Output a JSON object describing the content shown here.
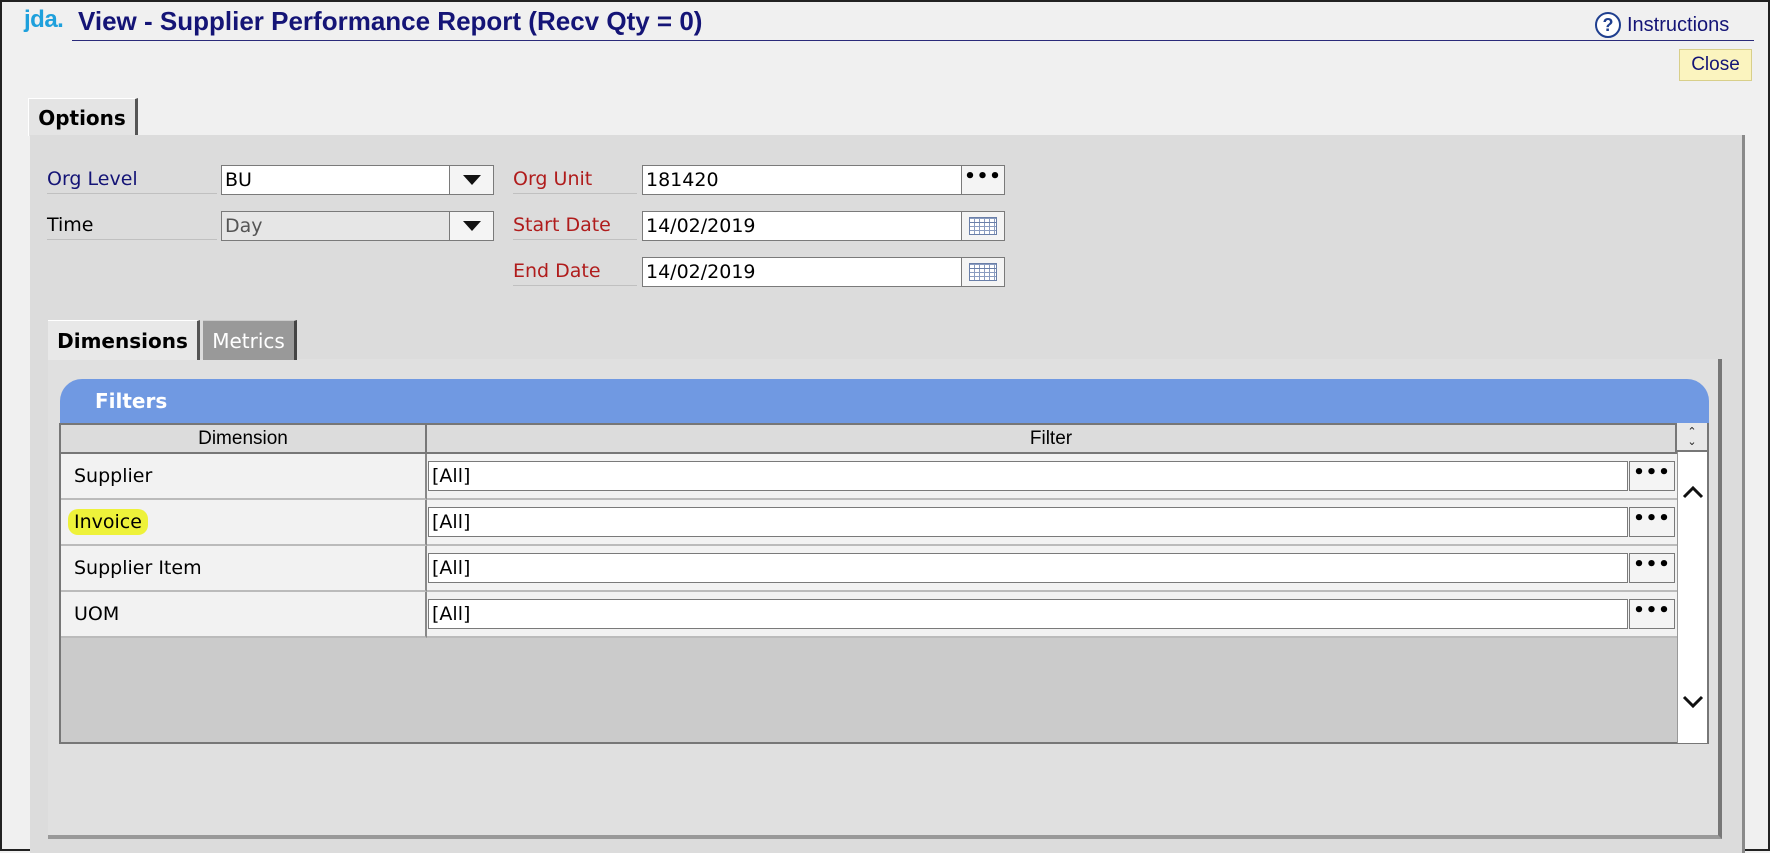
{
  "header": {
    "logo": "jda.",
    "title": "View - Supplier Performance Report (Recv Qty = 0)",
    "help_label": "Instructions",
    "help_icon_glyph": "?",
    "close_label": "Close"
  },
  "tabs": {
    "options_label": "Options"
  },
  "form": {
    "org_level": {
      "label": "Org Level",
      "value": "BU"
    },
    "time": {
      "label": "Time",
      "value": "Day"
    },
    "org_unit": {
      "label": "Org Unit",
      "value": "181420"
    },
    "start_date": {
      "label": "Start Date",
      "value": "14/02/2019"
    },
    "end_date": {
      "label": "End Date",
      "value": "14/02/2019"
    },
    "lookup_glyph": "•••"
  },
  "inner_tabs": {
    "dimensions_label": "Dimensions",
    "metrics_label": "Metrics"
  },
  "filters": {
    "title": "Filters",
    "columns": [
      "Dimension",
      "Filter"
    ],
    "rows": [
      {
        "dimension": "Supplier",
        "filter": "[All]"
      },
      {
        "dimension": "Invoice",
        "filter": "[All]",
        "highlighted": true
      },
      {
        "dimension": "Supplier Item",
        "filter": "[All]"
      },
      {
        "dimension": "UOM",
        "filter": "[All]"
      }
    ],
    "scroll_up_glyph": "^",
    "scroll_down_glyph": "v"
  },
  "colors": {
    "brand_logo": "#1ea0dc",
    "title_text": "#141476",
    "required_label": "#b01c1c",
    "filters_header": "#7099e2",
    "close_button_bg": "#fbf4bf",
    "highlight": "#eef23a"
  }
}
